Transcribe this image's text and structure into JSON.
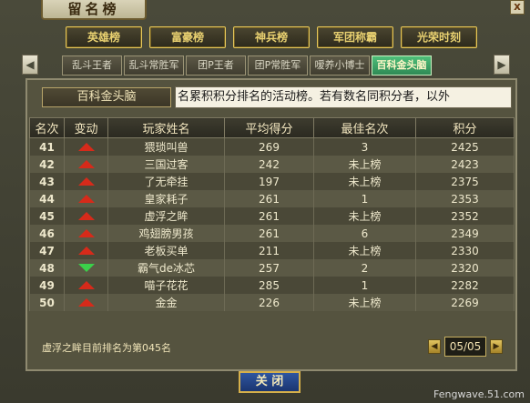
{
  "window": {
    "title": "留名榜",
    "close_label": "x"
  },
  "category_tabs": [
    {
      "label": "英雄榜"
    },
    {
      "label": "富豪榜"
    },
    {
      "label": "神兵榜"
    },
    {
      "label": "军团称霸"
    },
    {
      "label": "光荣时刻"
    }
  ],
  "sub_tabs": [
    {
      "label": "乱斗王者",
      "active": false
    },
    {
      "label": "乱斗常胜军",
      "active": false
    },
    {
      "label": "团P王者",
      "active": false
    },
    {
      "label": "团P常胜军",
      "active": false
    },
    {
      "label": "嗳养小博士",
      "active": false
    },
    {
      "label": "百科金头脑",
      "active": true
    }
  ],
  "nav": {
    "prev_label": "◀",
    "next_label": "▶"
  },
  "panel": {
    "title": "百科金头脑",
    "marquee": "名累积积分排名的活动榜。若有数名同积分者，以外"
  },
  "table": {
    "headers": [
      "名次",
      "变动",
      "玩家姓名",
      "平均得分",
      "最佳名次",
      "积分"
    ],
    "rows": [
      {
        "rank": "41",
        "change": "up",
        "name": "猥琐叫兽",
        "avg": "269",
        "best": "3",
        "score": "2425"
      },
      {
        "rank": "42",
        "change": "up",
        "name": "三国过客",
        "avg": "242",
        "best": "未上榜",
        "score": "2423"
      },
      {
        "rank": "43",
        "change": "up",
        "name": "了无牵挂",
        "avg": "197",
        "best": "未上榜",
        "score": "2375"
      },
      {
        "rank": "44",
        "change": "up",
        "name": "皇家耗子",
        "avg": "261",
        "best": "1",
        "score": "2353"
      },
      {
        "rank": "45",
        "change": "up",
        "name": "虚浮之眸",
        "avg": "261",
        "best": "未上榜",
        "score": "2352"
      },
      {
        "rank": "46",
        "change": "up",
        "name": "鸡翅膀男孩",
        "avg": "261",
        "best": "6",
        "score": "2349"
      },
      {
        "rank": "47",
        "change": "up",
        "name": "老板买单",
        "avg": "211",
        "best": "未上榜",
        "score": "2330"
      },
      {
        "rank": "48",
        "change": "down",
        "name": "霸气de冰芯",
        "avg": "257",
        "best": "2",
        "score": "2320"
      },
      {
        "rank": "49",
        "change": "up",
        "name": "喵子花花",
        "avg": "285",
        "best": "1",
        "score": "2282"
      },
      {
        "rank": "50",
        "change": "up",
        "name": "金金",
        "avg": "226",
        "best": "未上榜",
        "score": "2269"
      }
    ]
  },
  "status": {
    "text": "虚浮之眸目前排名为第045名"
  },
  "pager": {
    "prev_label": "◀",
    "next_label": "▶",
    "page": "05/05"
  },
  "footer": {
    "close_label": "关 闭",
    "watermark": "Fengwave.51.com"
  }
}
